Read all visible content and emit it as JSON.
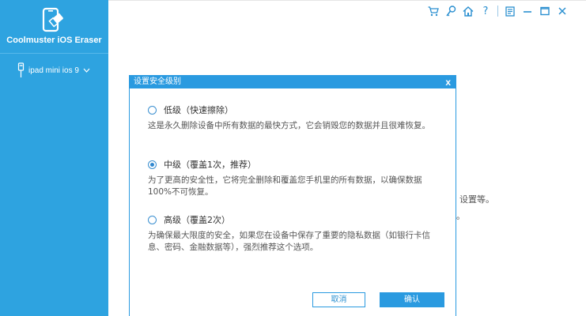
{
  "app": {
    "name": "Coolmuster iOS Eraser",
    "logo_icon": "eraser-phone-icon"
  },
  "device": {
    "name": "ipad mini ios 9"
  },
  "toolbar": {
    "icons": [
      "cart-icon",
      "key-icon",
      "home-icon",
      "help-icon",
      "feedback-icon",
      "minimize-icon",
      "maximize-icon",
      "close-icon"
    ],
    "help_label": "?"
  },
  "background": {
    "partial_text": "、设置等。",
    "partial_dot": "。"
  },
  "dialog": {
    "title": "设置安全级别",
    "close_label": "x",
    "options": [
      {
        "label": "低级（快速擦除）",
        "description": "这是永久删除设备中所有数据的最快方式，它会销毁您的数据并且很难恢复。",
        "selected": false
      },
      {
        "label": "中级（覆盖1次，推荐）",
        "description": "为了更高的安全性，它将完全删除和覆盖您手机里的所有数据，以确保数据100%不可恢复。",
        "selected": true
      },
      {
        "label": "高级（覆盖2次）",
        "description": "为确保最大限度的安全，如果您在设备中保存了重要的隐私数据（如银行卡信息、密码、金融数据等），强烈推荐这个选项。",
        "selected": false
      }
    ],
    "cancel_label": "取消",
    "ok_label": "确认"
  },
  "colors": {
    "accent": "#2ea3e0",
    "dialog_header": "#2a9ae0"
  }
}
